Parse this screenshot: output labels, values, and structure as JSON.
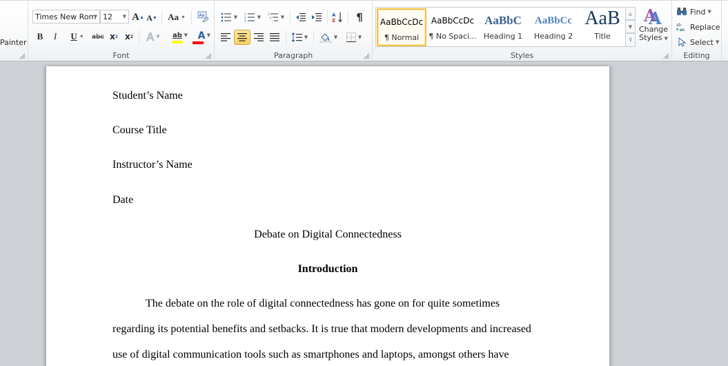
{
  "ribbon": {
    "clipboard": {
      "format_painter_label": "Painter"
    },
    "font": {
      "group_label": "Font",
      "font_name": "Times New Rom",
      "font_size": "12",
      "grow_font": "A",
      "shrink_font": "A",
      "change_case": "Aa",
      "bold": "B",
      "italic": "I",
      "underline": "U",
      "strikethrough": "abc",
      "subscript": "x",
      "superscript": "x",
      "text_effects": "A",
      "highlight": "ab",
      "font_color": "A",
      "highlight_color": "#ffff00",
      "font_color_value": "#ff0000"
    },
    "paragraph": {
      "group_label": "Paragraph",
      "show_marks": "¶"
    },
    "styles": {
      "group_label": "Styles",
      "items": [
        {
          "preview": "AaBbCcDc",
          "name": "¶ Normal",
          "selected": true
        },
        {
          "preview": "AaBbCcDc",
          "name": "¶ No Spaci...",
          "selected": false
        },
        {
          "preview": "AaBbC",
          "name": "Heading 1",
          "selected": false
        },
        {
          "preview": "AaBbCc",
          "name": "Heading 2",
          "selected": false
        },
        {
          "preview": "AaB",
          "name": "Title",
          "selected": false
        }
      ],
      "change_styles_line1": "Change",
      "change_styles_line2": "Styles"
    },
    "editing": {
      "group_label": "Editing",
      "find": "Find",
      "replace": "Replace",
      "select": "Select"
    }
  },
  "document": {
    "lines": [
      "Student’s Name",
      "Course Title",
      "Instructor’s Name",
      "Date"
    ],
    "title": "Debate on Digital Connectedness",
    "heading": "Introduction",
    "body": [
      "The debate on the role of digital connectedness has gone on for quite sometimes",
      "regarding its potential benefits and setbacks. It is true that modern developments and increased",
      "use of digital communication tools such as smartphones and laptops, amongst others have"
    ]
  }
}
